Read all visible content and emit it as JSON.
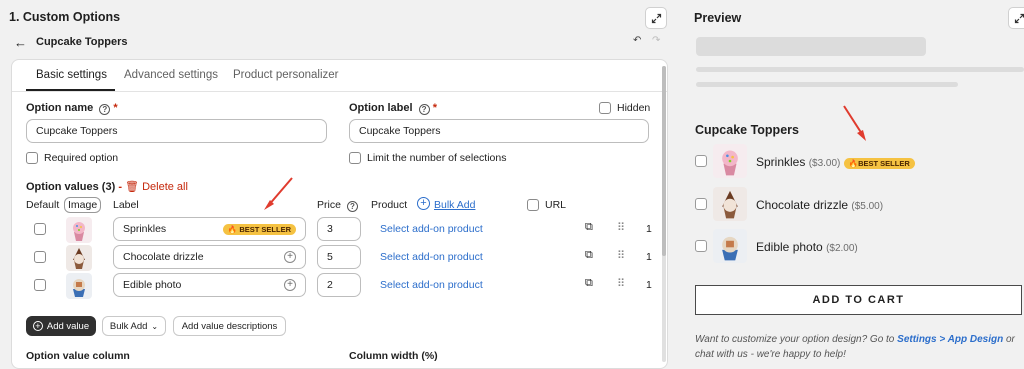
{
  "header": {
    "title": "1. Custom Options",
    "back_label": "Cupcake Toppers"
  },
  "tabs": [
    {
      "label": "Basic settings",
      "active": true
    },
    {
      "label": "Advanced settings",
      "active": false
    },
    {
      "label": "Product personalizer",
      "active": false
    }
  ],
  "form": {
    "option_name_label": "Option name",
    "option_name_value": "Cupcake Toppers",
    "option_label_label": "Option label",
    "option_label_value": "Cupcake Toppers",
    "hidden_label": "Hidden",
    "required_label": "Required option",
    "limit_label": "Limit the number of selections",
    "option_values_label": "Option values (3)",
    "delete_all_label": "Delete all"
  },
  "columns": {
    "default": "Default",
    "image": "Image",
    "label": "Label",
    "price": "Price",
    "product": "Product",
    "bulk_add": "Bulk Add",
    "url": "URL"
  },
  "rows": [
    {
      "label": "Sprinkles",
      "price": "3",
      "product": "Select add-on product",
      "badge": "BEST SELLER",
      "index": "1"
    },
    {
      "label": "Chocolate drizzle",
      "price": "5",
      "product": "Select add-on product",
      "badge": "",
      "index": "1"
    },
    {
      "label": "Edible photo",
      "price": "2",
      "product": "Select add-on product",
      "badge": "",
      "index": "1"
    }
  ],
  "buttons": {
    "add_value": "Add value",
    "bulk_add": "Bulk Add",
    "add_descriptions": "Add value descriptions"
  },
  "footer_fields": {
    "option_value_column": "Option value column",
    "column_width": "Column width (%)"
  },
  "preview": {
    "title": "Preview",
    "option_title": "Cupcake Toppers",
    "items": [
      {
        "name": "Sprinkles",
        "price": "($3.00)",
        "badge": "BEST SELLER"
      },
      {
        "name": "Chocolate drizzle",
        "price": "($5.00)",
        "badge": ""
      },
      {
        "name": "Edible photo",
        "price": "($2.00)",
        "badge": ""
      }
    ],
    "add_to_cart": "ADD TO CART",
    "note_prefix": "Want to customize your option design? Go to ",
    "note_link": "Settings > App Design",
    "note_suffix": " or chat with us - we're happy to help!"
  },
  "colors": {
    "accent_link": "#2c6ecb",
    "required": "#c5280c",
    "badge": "#f5c242",
    "arrow": "#e03b2e"
  }
}
